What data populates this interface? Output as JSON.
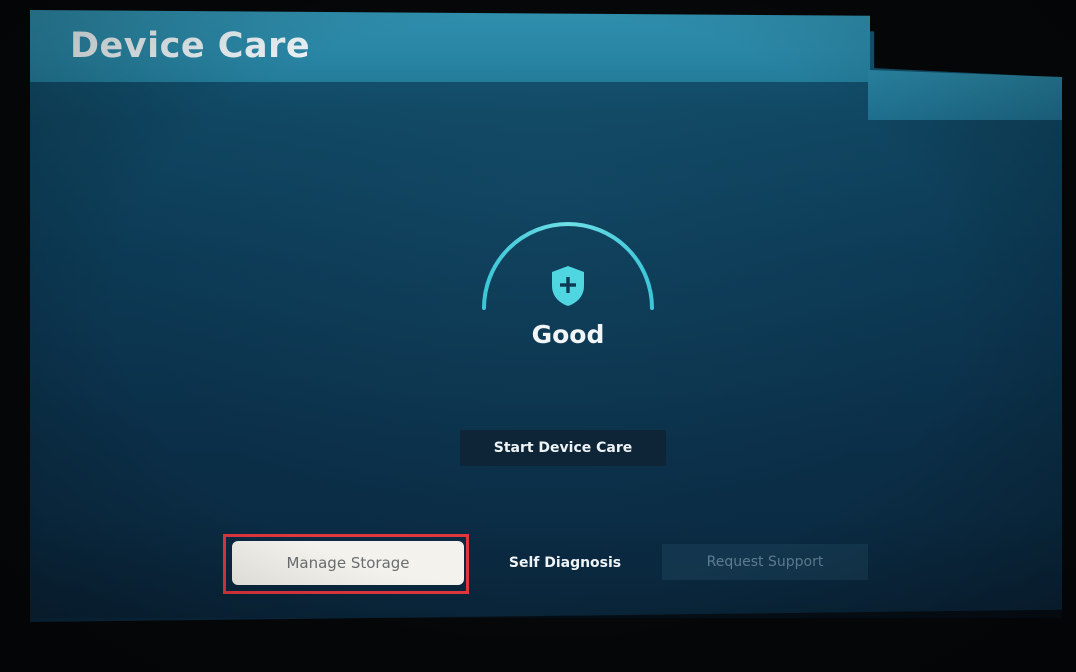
{
  "header": {
    "title": "Device Care"
  },
  "status": {
    "label": "Good",
    "icon": "shield-plus-icon",
    "accent_color": "#4fd6e0"
  },
  "actions": {
    "start_label": "Start Device Care"
  },
  "menu": {
    "items": [
      {
        "label": "Manage Storage",
        "state": "focused"
      },
      {
        "label": "Self Diagnosis",
        "state": "normal"
      },
      {
        "label": "Request Support",
        "state": "disabled"
      }
    ],
    "highlight_color": "#e0363d"
  }
}
